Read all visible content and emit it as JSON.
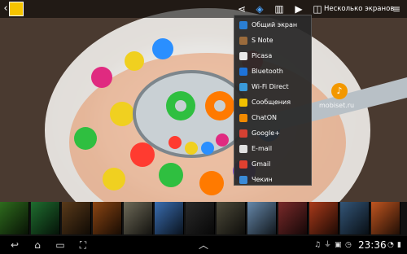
{
  "topbar": {
    "multi_screen_label": "Несколько экранов",
    "icons": [
      "back-icon",
      "gallery-app-icon",
      "share-icon",
      "dropbox-icon",
      "trash-icon",
      "slideshow-icon",
      "multi-screen-icon",
      "menu-icon"
    ]
  },
  "share_menu": {
    "items": [
      {
        "label": "Общий экран",
        "icon": "share-screen-icon",
        "color": "#2a7fd4"
      },
      {
        "label": "S Note",
        "icon": "snote-icon",
        "color": "#9a6b3c"
      },
      {
        "label": "Picasa",
        "icon": "picasa-icon",
        "color": "#e8e8e8"
      },
      {
        "label": "Bluetooth",
        "icon": "bluetooth-icon",
        "color": "#1e73d8"
      },
      {
        "label": "Wi-Fi Direct",
        "icon": "wifi-direct-icon",
        "color": "#3a9ad9"
      },
      {
        "label": "Сообщения",
        "icon": "messages-icon",
        "color": "#f0c000"
      },
      {
        "label": "ChatON",
        "icon": "chaton-icon",
        "color": "#f08a00"
      },
      {
        "label": "Google+",
        "icon": "googleplus-icon",
        "color": "#d44132"
      },
      {
        "label": "E-mail",
        "icon": "email-icon",
        "color": "#e0e0e0"
      },
      {
        "label": "Gmail",
        "icon": "gmail-icon",
        "color": "#e04030"
      },
      {
        "label": "Чекин",
        "icon": "checkin-icon",
        "color": "#3a8ad8"
      }
    ]
  },
  "watermark": {
    "text": "mobiset.ru",
    "logo": "♪"
  },
  "filmstrip": {
    "thumb_colors": [
      "#2e6b1d",
      "#1f6d2f",
      "#5a3a1a",
      "#8b4513",
      "#6e6a58",
      "#3a6db0",
      "#2a2a2a",
      "#4d4a3a",
      "#6688aa",
      "#7a2a2a",
      "#aa3a1a",
      "#335577",
      "#c05520"
    ]
  },
  "statusbar": {
    "time": "23:36",
    "icons": [
      "music-icon",
      "usb-icon",
      "screenshot-icon",
      "alarm-icon",
      "wifi-icon",
      "battery-icon"
    ]
  },
  "navbar": {
    "icons": [
      "nav-back-icon",
      "nav-home-icon",
      "nav-recent-icon",
      "nav-screenshot-icon",
      "nav-up-icon"
    ]
  }
}
